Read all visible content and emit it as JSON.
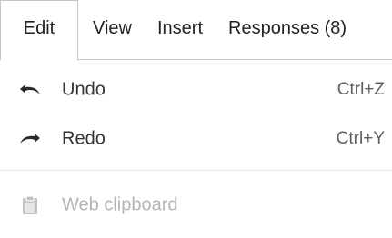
{
  "menubar": {
    "items": [
      {
        "label": "Edit"
      },
      {
        "label": "View"
      },
      {
        "label": "Insert"
      },
      {
        "label": "Responses (8)"
      }
    ]
  },
  "edit_menu": {
    "undo": {
      "label": "Undo",
      "shortcut": "Ctrl+Z",
      "icon": "undo-icon"
    },
    "redo": {
      "label": "Redo",
      "shortcut": "Ctrl+Y",
      "icon": "redo-icon"
    },
    "web_clipboard": {
      "label": "Web clipboard",
      "icon": "clipboard-icon",
      "disabled": true
    }
  },
  "colors": {
    "text": "#333333",
    "shortcut": "#5f5f5f",
    "disabled": "#b4b4b4",
    "border": "#c6c6c6"
  }
}
